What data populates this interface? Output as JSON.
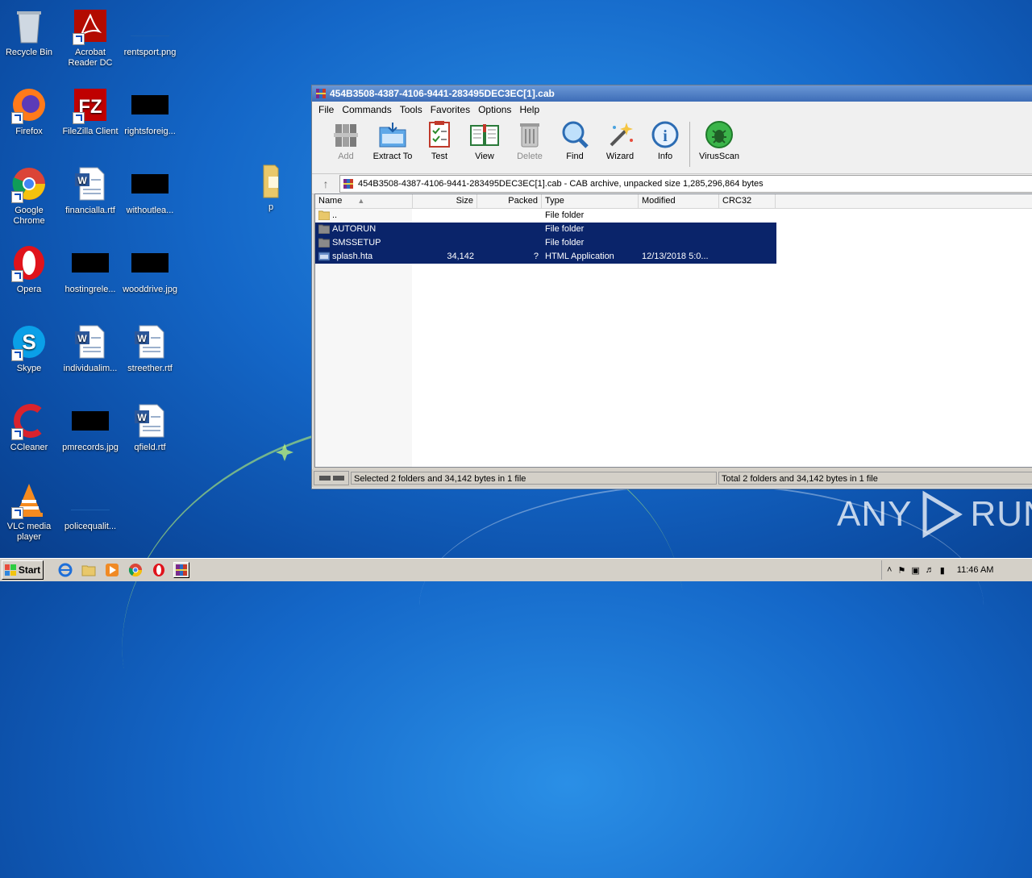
{
  "desktop": {
    "icons": [
      {
        "label": "Recycle Bin"
      },
      {
        "label": "Acrobat Reader DC"
      },
      {
        "label": "rentsport.png"
      },
      {
        "label": "Firefox"
      },
      {
        "label": "FileZilla Client"
      },
      {
        "label": "rightsforeig..."
      },
      {
        "label": "Google Chrome"
      },
      {
        "label": "financialla.rtf"
      },
      {
        "label": "withoutlea..."
      },
      {
        "label": "p"
      },
      {
        "label": "Opera"
      },
      {
        "label": "hostingrele..."
      },
      {
        "label": "wooddrive.jpg"
      },
      {
        "label": "Skype"
      },
      {
        "label": "individualim..."
      },
      {
        "label": "streether.rtf"
      },
      {
        "label": "CCleaner"
      },
      {
        "label": "pmrecords.jpg"
      },
      {
        "label": "qfield.rtf"
      },
      {
        "label": "VLC media player"
      },
      {
        "label": "policequalit..."
      }
    ],
    "watermark": "ANY RUN"
  },
  "window": {
    "title": "454B3508-4387-4106-9441-283495DEC3EC[1].cab",
    "menu": [
      "File",
      "Commands",
      "Tools",
      "Favorites",
      "Options",
      "Help"
    ],
    "toolbar": [
      {
        "label": "Add",
        "icon": "add-icon",
        "enabled": false
      },
      {
        "label": "Extract To",
        "icon": "extract-icon",
        "enabled": true
      },
      {
        "label": "Test",
        "icon": "test-icon",
        "enabled": true
      },
      {
        "label": "View",
        "icon": "view-icon",
        "enabled": true
      },
      {
        "label": "Delete",
        "icon": "delete-icon",
        "enabled": false
      },
      {
        "label": "Find",
        "icon": "find-icon",
        "enabled": true
      },
      {
        "label": "Wizard",
        "icon": "wizard-icon",
        "enabled": true
      },
      {
        "label": "Info",
        "icon": "info-icon",
        "enabled": true
      },
      {
        "label": "VirusScan",
        "icon": "virusscan-icon",
        "enabled": true
      }
    ],
    "path": "454B3508-4387-4106-9441-283495DEC3EC[1].cab - CAB archive, unpacked size 1,285,296,864 bytes",
    "columns": [
      "Name",
      "Size",
      "Packed",
      "Type",
      "Modified",
      "CRC32"
    ],
    "rows": [
      {
        "name": "..",
        "size": "",
        "packed": "",
        "type": "File folder",
        "modified": "",
        "crc": "",
        "selected": false
      },
      {
        "name": "AUTORUN",
        "size": "",
        "packed": "",
        "type": "File folder",
        "modified": "",
        "crc": "",
        "selected": true
      },
      {
        "name": "SMSSETUP",
        "size": "",
        "packed": "",
        "type": "File folder",
        "modified": "",
        "crc": "",
        "selected": true
      },
      {
        "name": "splash.hta",
        "size": "34,142",
        "packed": "?",
        "type": "HTML Application",
        "modified": "12/13/2018 5:0...",
        "crc": "",
        "selected": true
      }
    ],
    "status_left": "Selected 2 folders and 34,142 bytes in 1 file",
    "status_right": "Total 2 folders and 34,142 bytes in 1 file"
  },
  "taskbar": {
    "start": "Start",
    "clock": "11:46 AM"
  },
  "colors": {
    "selection": "#0a246a",
    "titlebar": "#3d6db7",
    "desktop": "#1467c8"
  }
}
